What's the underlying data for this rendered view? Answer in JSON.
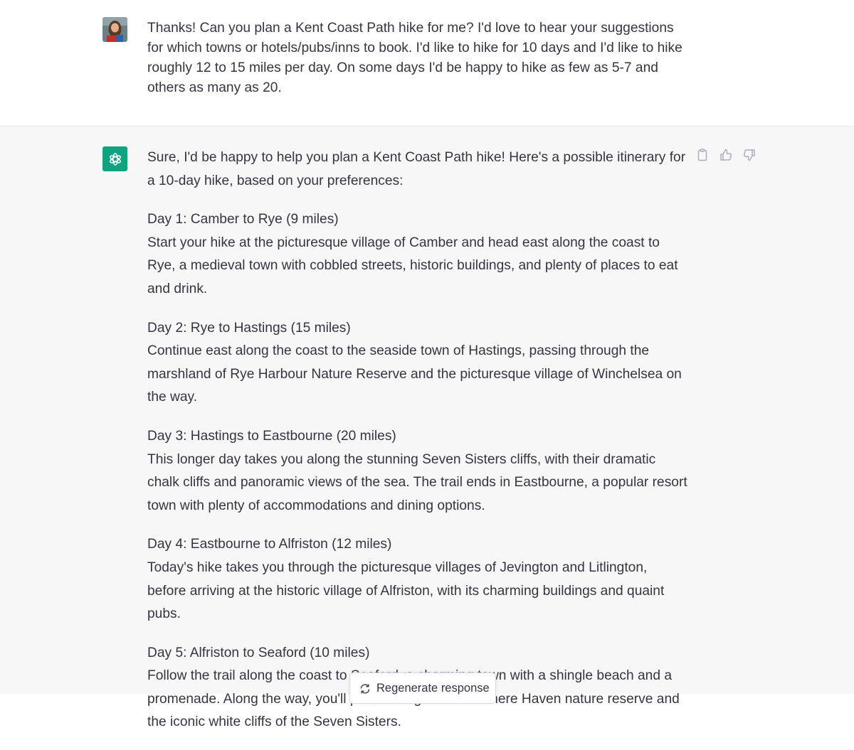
{
  "user_message": {
    "text": "Thanks! Can you plan a Kent Coast Path hike for me? I'd love to hear your suggestions for which towns or hotels/pubs/inns to book. I'd like to hike for 10 days and I'd like to hike roughly 12 to 15 miles per day. On some days I'd be happy to hike as few as 5-7 and others as many as 20."
  },
  "assistant_message": {
    "intro": "Sure, I'd be happy to help you plan a Kent Coast Path hike! Here's a possible itinerary for a 10-day hike, based on your preferences:",
    "days": [
      {
        "title": "Day 1: Camber to Rye (9 miles)",
        "body": "Start your hike at the picturesque village of Camber and head east along the coast to Rye, a medieval town with cobbled streets, historic buildings, and plenty of places to eat and drink."
      },
      {
        "title": "Day 2: Rye to Hastings (15 miles)",
        "body": "Continue east along the coast to the seaside town of Hastings, passing through the marshland of Rye Harbour Nature Reserve and the picturesque village of Winchelsea on the way."
      },
      {
        "title": "Day 3: Hastings to Eastbourne (20 miles)",
        "body": "This longer day takes you along the stunning Seven Sisters cliffs, with their dramatic chalk cliffs and panoramic views of the sea. The trail ends in Eastbourne, a popular resort town with plenty of accommodations and dining options."
      },
      {
        "title": "Day 4: Eastbourne to Alfriston (12 miles)",
        "body": "Today's hike takes you through the picturesque villages of Jevington and Litlington, before arriving at the historic village of Alfriston, with its charming buildings and quaint pubs."
      },
      {
        "title": "Day 5: Alfriston to Seaford (10 miles)",
        "body": "Follow the trail along the coast to Seaford, a charming town with a shingle beach and a promenade. Along the way, you'll pass through the Cuckmere Haven nature reserve and the iconic white cliffs of the Seven Sisters."
      }
    ]
  },
  "actions": {
    "copy_icon": "clipboard-icon",
    "like_icon": "thumbs-up-icon",
    "dislike_icon": "thumbs-down-icon"
  },
  "regenerate": {
    "label": "Regenerate response",
    "icon": "refresh-icon"
  },
  "colors": {
    "bot_avatar": "#10a37f",
    "assistant_bg": "#f7f7f8",
    "text": "#343541"
  }
}
